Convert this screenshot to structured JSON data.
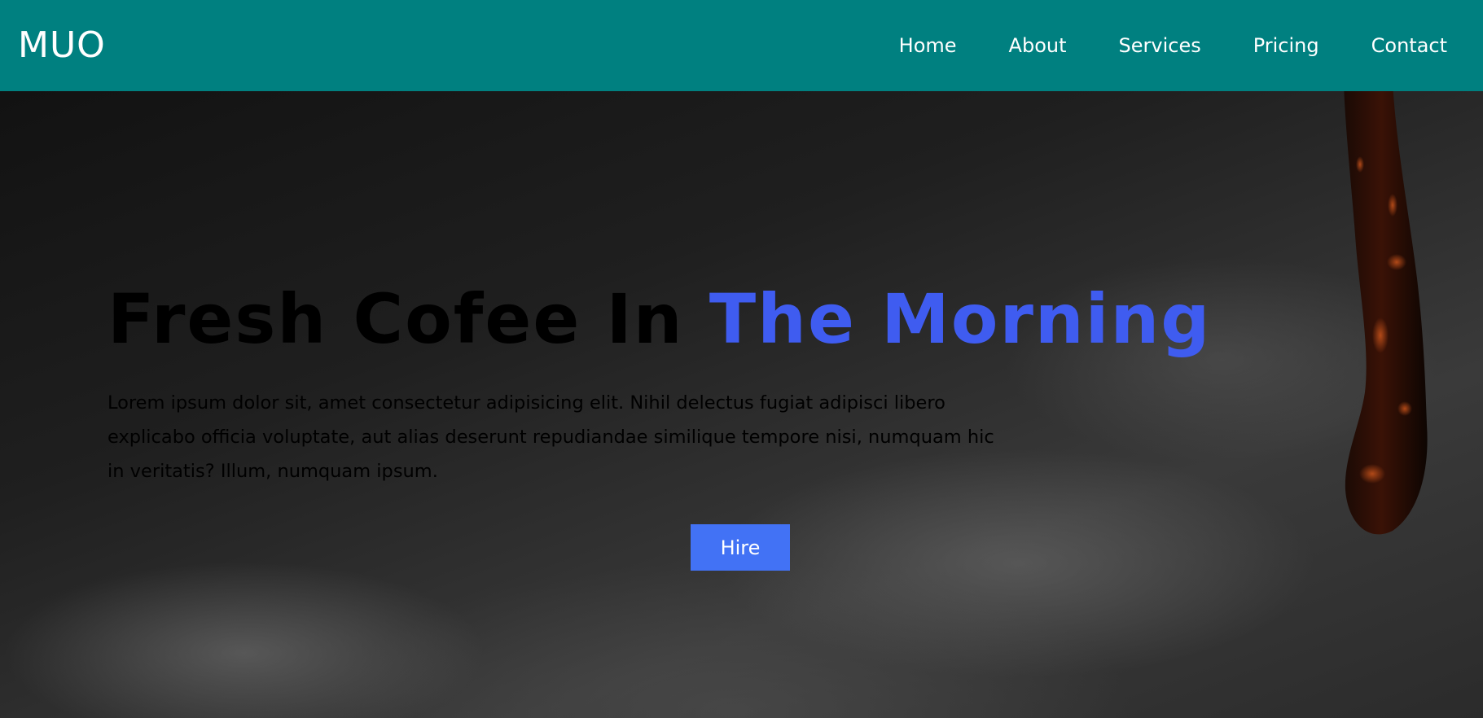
{
  "header": {
    "logo": "MUO",
    "nav": [
      "Home",
      "About",
      "Services",
      "Pricing",
      "Contact"
    ],
    "background_color": "#008080"
  },
  "hero": {
    "title_main": "Fresh Cofee In ",
    "title_accent": "The Morning",
    "accent_color": "#3f5cf0",
    "description": "Lorem ipsum dolor sit, amet consectetur adipisicing elit. Nihil delectus fugiat adipisci libero explicabo officia voluptate, aut alias deserunt repudiandae similique tempore nisi, numquam hic in veritatis? Illum, numquam ipsum.",
    "button_label": "Hire",
    "button_color": "#4272f5"
  }
}
